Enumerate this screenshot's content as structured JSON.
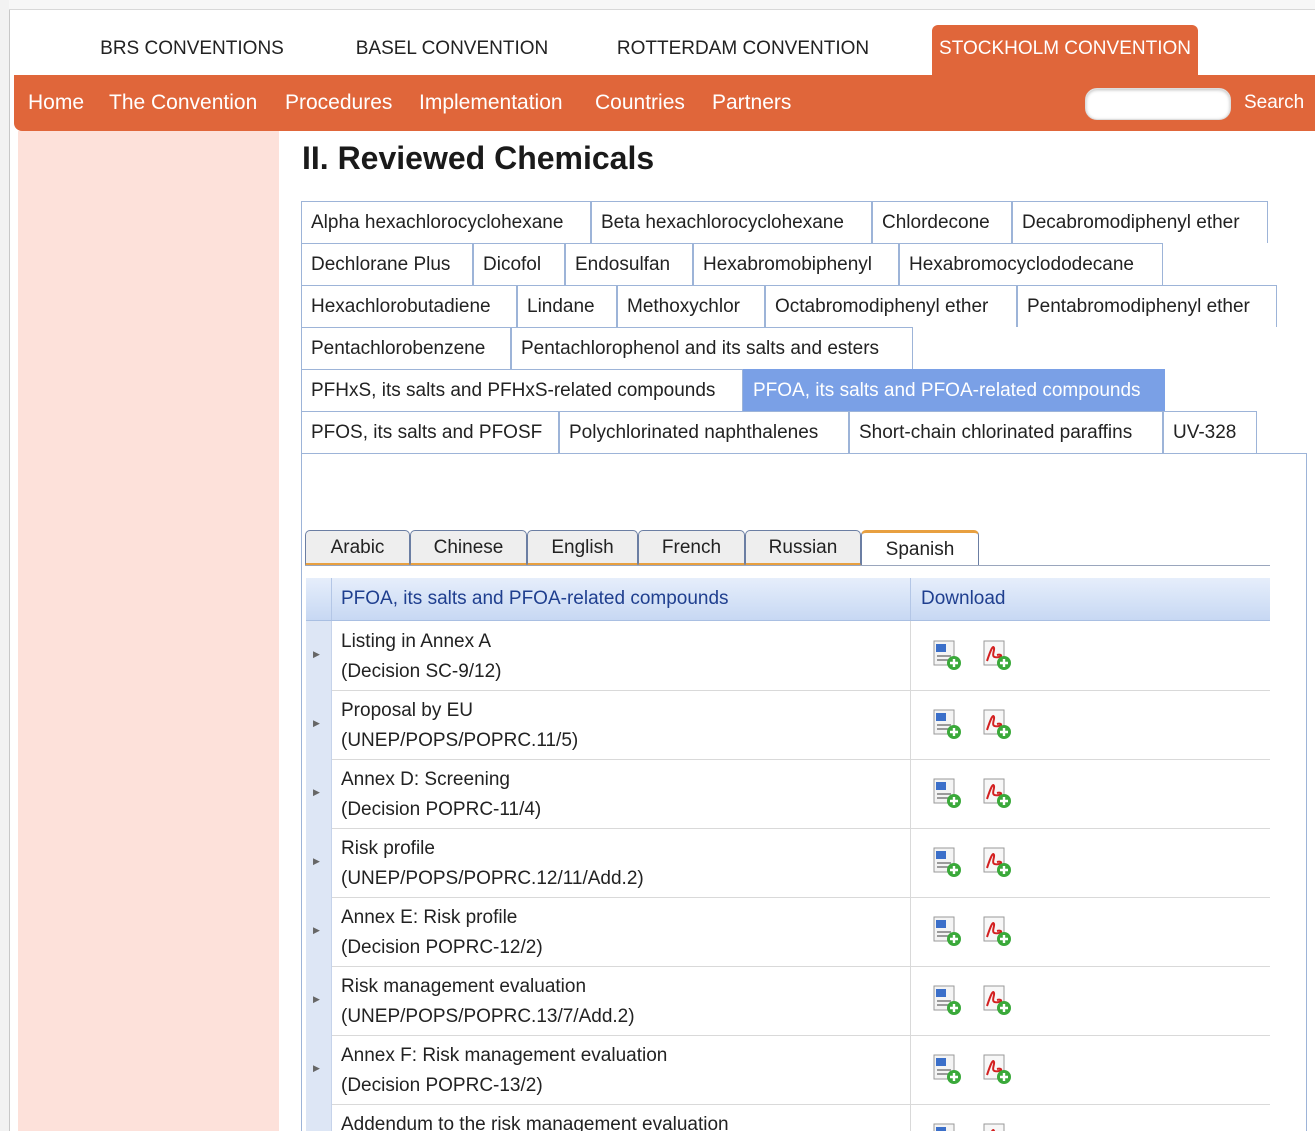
{
  "conventions": [
    {
      "label": "BRS CONVENTIONS",
      "active": false
    },
    {
      "label": "BASEL CONVENTION",
      "active": false
    },
    {
      "label": "ROTTERDAM CONVENTION",
      "active": false
    },
    {
      "label": "STOCKHOLM CONVENTION",
      "active": true
    }
  ],
  "nav": {
    "items": [
      "Home",
      "The Convention",
      "Procedures",
      "Implementation",
      "Countries",
      "Partners"
    ],
    "search_label": "Search",
    "search_value": ""
  },
  "page": {
    "title": "II. Reviewed Chemicals"
  },
  "chemical_tabs": {
    "items": [
      "Alpha hexachlorocyclohexane",
      "Beta hexachlorocyclohexane",
      "Chlordecone",
      "Decabromodiphenyl ether",
      "Dechlorane Plus",
      "Dicofol",
      "Endosulfan",
      "Hexabromobiphenyl",
      "Hexabromocyclododecane",
      "Hexachlorobutadiene",
      "Lindane",
      "Methoxychlor",
      "Octabromodiphenyl ether",
      "Pentabromodiphenyl ether",
      "Pentachlorobenzene",
      "Pentachlorophenol and its salts and esters",
      "PFHxS, its salts and PFHxS-related compounds",
      "PFOA, its salts and PFOA-related compounds",
      "PFOS, its salts and PFOSF",
      "Polychlorinated naphthalenes",
      "Short-chain chlorinated paraffins",
      "UV-328"
    ],
    "active": "PFOA, its salts and PFOA-related compounds"
  },
  "language_tabs": {
    "items": [
      "Arabic",
      "Chinese",
      "English",
      "French",
      "Russian",
      "Spanish"
    ],
    "active": "Spanish"
  },
  "grid": {
    "columns": [
      "PFOA, its salts and PFOA-related compounds",
      "Download"
    ],
    "rows": [
      {
        "title": "Listing in Annex A",
        "ref": "(Decision SC-9/12)"
      },
      {
        "title": "Proposal by EU",
        "ref": "(UNEP/POPS/POPRC.11/5)"
      },
      {
        "title": "Annex D: Screening",
        "ref": "(Decision POPRC-11/4)"
      },
      {
        "title": "Risk profile",
        "ref": "(UNEP/POPS/POPRC.12/11/Add.2)"
      },
      {
        "title": "Annex E: Risk profile",
        "ref": "(Decision POPRC-12/2)"
      },
      {
        "title": "Risk management evaluation",
        "ref": "(UNEP/POPS/POPRC.13/7/Add.2)"
      },
      {
        "title": "Annex F: Risk management evaluation",
        "ref": "(Decision POPRC-13/2)"
      },
      {
        "title": "Addendum to the risk management evaluation",
        "ref": ""
      }
    ],
    "download_icons": [
      "word-download-icon",
      "pdf-download-icon"
    ]
  },
  "colors": {
    "brand": "#e0663a",
    "active_tab": "#7aa0e6",
    "left_panel": "#fde1da"
  }
}
